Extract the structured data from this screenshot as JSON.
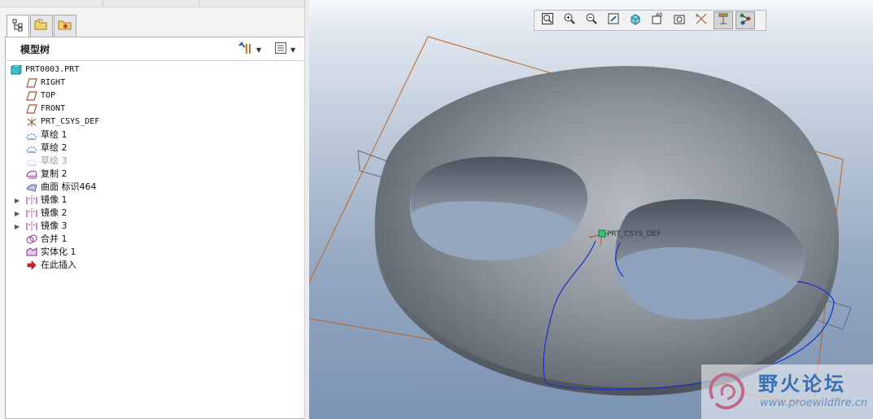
{
  "left_panel": {
    "tabs": [
      {
        "name": "model-tree-tab",
        "icon": "model-tree-icon",
        "active": true
      },
      {
        "name": "folder-browser-tab",
        "icon": "folder-icon",
        "active": false
      },
      {
        "name": "favorites-tab",
        "icon": "favorites-icon",
        "active": false
      }
    ],
    "title": "模型树",
    "settings_icon": "tree-settings-icon",
    "columns_icon": "show-columns-icon",
    "tree": [
      {
        "label": "PRT0003.PRT",
        "icon": "part-icon",
        "mono": true
      },
      {
        "label": "RIGHT",
        "icon": "datum-plane-icon",
        "mono": true
      },
      {
        "label": "TOP",
        "icon": "datum-plane-icon",
        "mono": true
      },
      {
        "label": "FRONT",
        "icon": "datum-plane-icon",
        "mono": true
      },
      {
        "label": "PRT_CSYS_DEF",
        "icon": "csys-icon",
        "mono": true
      },
      {
        "label": "草绘 1",
        "icon": "sketch-icon"
      },
      {
        "label": "草绘 2",
        "icon": "sketch-icon"
      },
      {
        "label": "草绘 3",
        "icon": "sketch-icon",
        "dim": true
      },
      {
        "label": "复制 2",
        "icon": "copy-icon"
      },
      {
        "label": "曲面 标识464",
        "icon": "surface-icon"
      },
      {
        "label": "镜像 1",
        "icon": "mirror-icon",
        "expandable": true
      },
      {
        "label": "镜像 2",
        "icon": "mirror-icon",
        "expandable": true
      },
      {
        "label": "镜像 3",
        "icon": "mirror-icon",
        "expandable": true
      },
      {
        "label": "合并 1",
        "icon": "merge-icon"
      },
      {
        "label": "实体化 1",
        "icon": "solidify-icon"
      },
      {
        "label": "在此插入",
        "icon": "insert-here-arrow-icon"
      }
    ]
  },
  "viewport": {
    "toolbar": [
      {
        "name": "refit-button",
        "icon": "refit-icon"
      },
      {
        "name": "zoom-in-button",
        "icon": "zoom-in-icon"
      },
      {
        "name": "zoom-out-button",
        "icon": "zoom-out-icon"
      },
      {
        "name": "repaint-button",
        "icon": "repaint-icon"
      },
      {
        "name": "display-style-button",
        "icon": "shaded-cube-icon"
      },
      {
        "name": "saved-views-button",
        "icon": "saved-views-icon"
      },
      {
        "name": "view-manager-button",
        "icon": "view-manager-icon"
      },
      {
        "name": "datum-display-button",
        "icon": "datum-display-icon"
      },
      {
        "name": "annotation-display-button",
        "icon": "annotation-display-icon",
        "pressed": true
      },
      {
        "name": "spin-center-button",
        "icon": "spin-center-icon",
        "pressed": true
      }
    ],
    "csys_label": "PRT_CSYS_DEF",
    "colors": {
      "model": "#8a9099",
      "datum_plane": "#c0651f",
      "curve": "#1b2fc8",
      "background_top": "#f6f8fb",
      "background_bottom": "#7c93b3"
    }
  },
  "watermark": {
    "title": "野火论坛",
    "url": "www.proewildfire.cn",
    "logo_icon": "wildfire-logo-icon"
  }
}
